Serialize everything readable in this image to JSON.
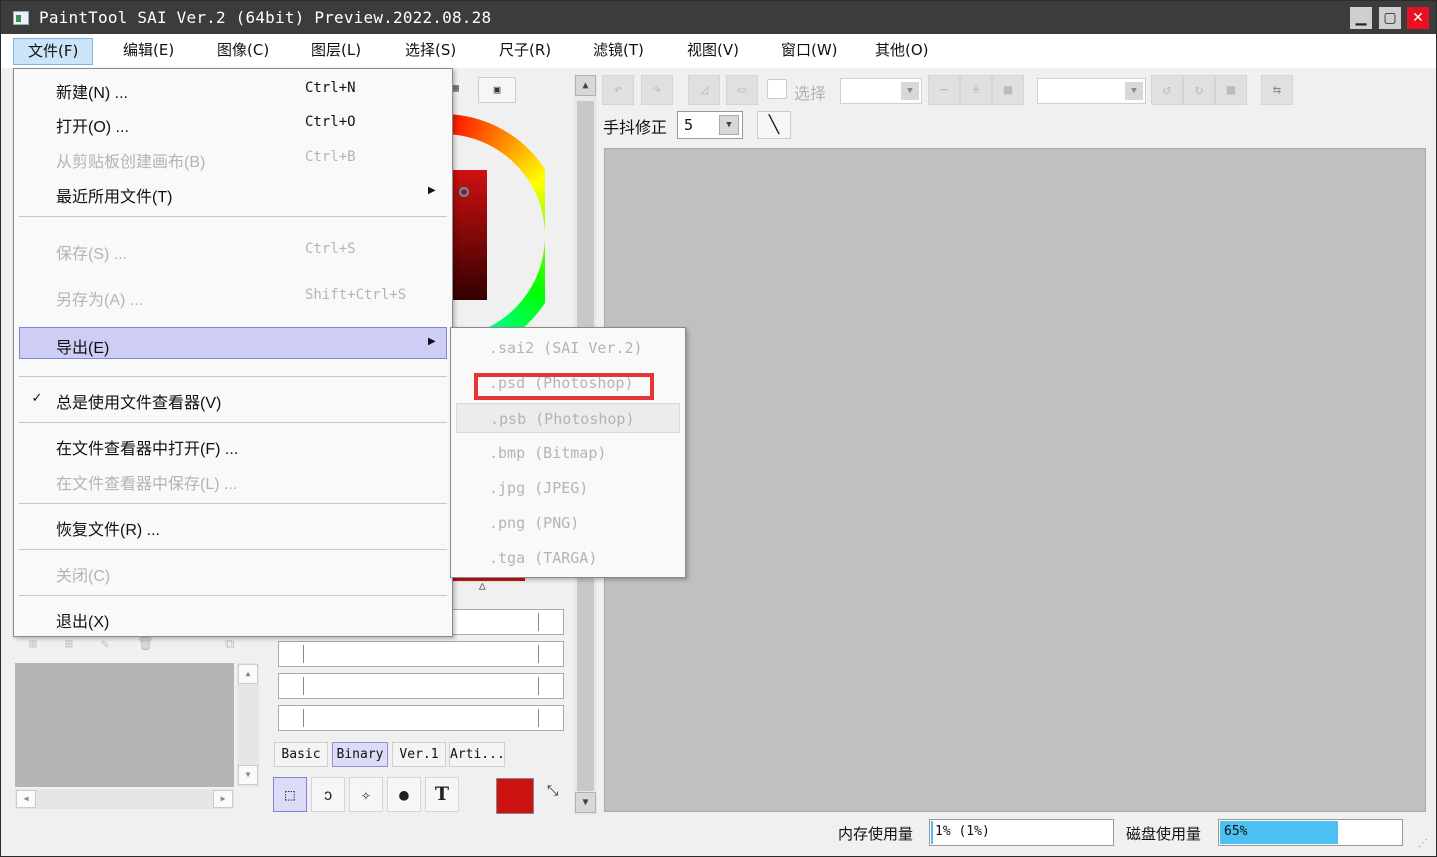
{
  "window": {
    "title": "PaintTool SAI Ver.2 (64bit) Preview.2022.08.28",
    "min": "▁",
    "max": "▢",
    "close": "✕"
  },
  "menubar": {
    "items": [
      {
        "label": "文件(F)"
      },
      {
        "label": "编辑(E)"
      },
      {
        "label": "图像(C)"
      },
      {
        "label": "图层(L)"
      },
      {
        "label": "选择(S)"
      },
      {
        "label": "尺子(R)"
      },
      {
        "label": "滤镜(T)"
      },
      {
        "label": "视图(V)"
      },
      {
        "label": "窗口(W)"
      },
      {
        "label": "其他(O)"
      }
    ]
  },
  "file_menu": {
    "new": {
      "label": "新建(N) ...",
      "shortcut": "Ctrl+N"
    },
    "open": {
      "label": "打开(O) ...",
      "shortcut": "Ctrl+O"
    },
    "from_clipboard": {
      "label": "从剪贴板创建画布(B)",
      "shortcut": "Ctrl+B"
    },
    "recent": {
      "label": "最近所用文件(T)"
    },
    "save": {
      "label": "保存(S) ...",
      "shortcut": "Ctrl+S"
    },
    "save_as": {
      "label": "另存为(A) ...",
      "shortcut": "Shift+Ctrl+S"
    },
    "export": {
      "label": "导出(E)"
    },
    "always_viewer": {
      "label": "总是使用文件查看器(V)",
      "check": "✓"
    },
    "open_in_viewer": {
      "label": "在文件查看器中打开(F) ..."
    },
    "save_in_viewer": {
      "label": "在文件查看器中保存(L) ..."
    },
    "recover": {
      "label": "恢复文件(R) ..."
    },
    "close": {
      "label": "关闭(C)"
    },
    "exit": {
      "label": "退出(X)"
    }
  },
  "export_submenu": [
    ".sai2 (SAI Ver.2)",
    ".psd (Photoshop)",
    ".psb (Photoshop)",
    ".bmp (Bitmap)",
    ".jpg (JPEG)",
    ".png (PNG)",
    ".tga (TARGA)"
  ],
  "toolbar": {
    "select_label": "选择",
    "stabilizer_label": "手抖修正",
    "stabilizer_value": "5"
  },
  "brush_tabs": [
    "Basic",
    "Binary",
    "Ver.1",
    "Arti..."
  ],
  "status": {
    "memory_label": "内存使用量",
    "memory_value": "1% (1%)",
    "memory_fraction": 0.01,
    "disk_label": "磁盘使用量",
    "disk_value": "65%",
    "disk_fraction": 0.65
  },
  "colors": {
    "accent_highlight": "#cdcdf5",
    "annotation_red": "#e73535",
    "current_color": "#cc1111"
  }
}
